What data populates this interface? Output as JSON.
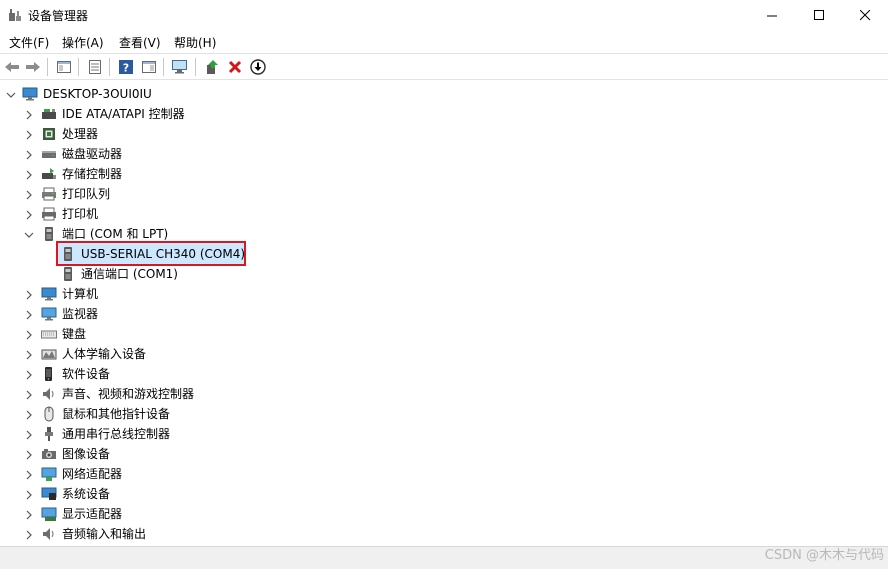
{
  "window": {
    "title": "设备管理器",
    "controls": [
      "minimize-icon",
      "maximize-icon",
      "close-icon"
    ]
  },
  "menu": {
    "items": [
      "文件(F)",
      "操作(A)",
      "查看(V)",
      "帮助(H)"
    ]
  },
  "toolbar": {
    "buttons": [
      "back-arrow-icon",
      "forward-arrow-icon",
      "show-hide-tree-icon",
      "properties-icon",
      "help-icon",
      "view-icon",
      "scan-hardware-icon",
      "update-driver-icon",
      "uninstall-icon",
      "download-icon"
    ]
  },
  "tree": {
    "root": "DESKTOP-3OUI0IU",
    "categories": [
      {
        "label": "IDE ATA/ATAPI 控制器",
        "icon": "ide-controller-icon"
      },
      {
        "label": "处理器",
        "icon": "processor-icon"
      },
      {
        "label": "磁盘驱动器",
        "icon": "disk-drive-icon"
      },
      {
        "label": "存储控制器",
        "icon": "storage-controller-icon"
      },
      {
        "label": "打印队列",
        "icon": "print-queue-icon"
      },
      {
        "label": "打印机",
        "icon": "printer-icon"
      },
      {
        "label": "端口 (COM 和 LPT)",
        "icon": "port-icon"
      },
      {
        "label": "计算机",
        "icon": "computer-icon"
      },
      {
        "label": "监视器",
        "icon": "monitor-icon"
      },
      {
        "label": "键盘",
        "icon": "keyboard-icon"
      },
      {
        "label": "人体学输入设备",
        "icon": "hid-icon"
      },
      {
        "label": "软件设备",
        "icon": "software-device-icon"
      },
      {
        "label": "声音、视频和游戏控制器",
        "icon": "sound-icon"
      },
      {
        "label": "鼠标和其他指针设备",
        "icon": "mouse-icon"
      },
      {
        "label": "通用串行总线控制器",
        "icon": "usb-icon"
      },
      {
        "label": "图像设备",
        "icon": "imaging-device-icon"
      },
      {
        "label": "网络适配器",
        "icon": "network-adapter-icon"
      },
      {
        "label": "系统设备",
        "icon": "system-device-icon"
      },
      {
        "label": "显示适配器",
        "icon": "display-adapter-icon"
      },
      {
        "label": "音频输入和输出",
        "icon": "audio-io-icon"
      }
    ],
    "port_children": [
      {
        "label": "USB-SERIAL CH340 (COM4)",
        "selected": true
      },
      {
        "label": "通信端口 (COM1)",
        "selected": false
      }
    ]
  },
  "watermark": "CSDN @木木与代码",
  "colors": {
    "highlight_border": "#e0141c",
    "selection_bg": "#cce8ff"
  }
}
